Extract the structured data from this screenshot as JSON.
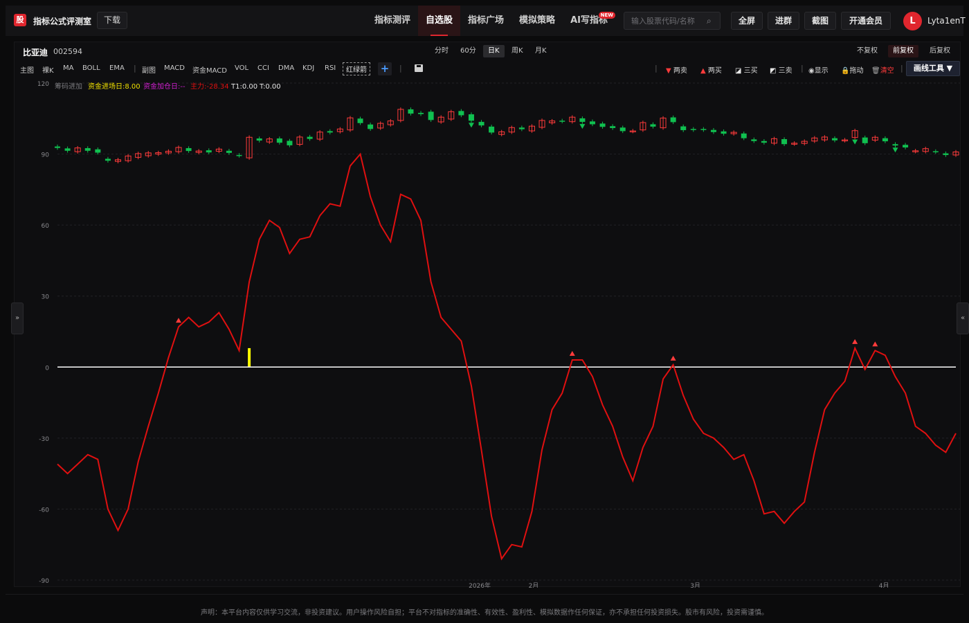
{
  "app": {
    "logo_char": "股",
    "title": "指标公式评测室",
    "download_label": "下载"
  },
  "nav": [
    {
      "label": "指标测评",
      "active": false,
      "badge": ""
    },
    {
      "label": "自选股",
      "active": true,
      "badge": ""
    },
    {
      "label": "指标广场",
      "active": false,
      "badge": ""
    },
    {
      "label": "模拟策略",
      "active": false,
      "badge": ""
    },
    {
      "label": "AI写指标",
      "active": false,
      "badge": "NEW"
    }
  ],
  "search": {
    "placeholder": "输入股票代码/名称"
  },
  "toolbar": {
    "fullscreen": "全屏",
    "join_group": "进群",
    "screenshot": "截图",
    "vip": "开通会员"
  },
  "user": {
    "avatar_letter": "L",
    "name": "Lyta1enT"
  },
  "stock": {
    "name": "比亚迪",
    "code": "002594"
  },
  "periods": [
    "分时",
    "60分",
    "日K",
    "周K",
    "月K"
  ],
  "active_period": "日K",
  "adjustments": [
    "不复权",
    "前复权",
    "后复权"
  ],
  "active_adjustment": "前复权",
  "indicators_main": [
    "主图",
    "裸K",
    "MA",
    "BOLL",
    "EMA"
  ],
  "indicators_sub": [
    "副图",
    "MACD",
    "资金MACD",
    "VOL",
    "CCI",
    "DMA",
    "KDJ",
    "RSI"
  ],
  "red_green_label": "红绿箭",
  "draw_actions": [
    {
      "label": "两卖",
      "icon": "red-down-triangle"
    },
    {
      "label": "两买",
      "icon": "red-up-triangle"
    },
    {
      "label": "三买",
      "icon": "chart-icon"
    },
    {
      "label": "三卖",
      "icon": "chart-icon"
    },
    {
      "label": "显示",
      "icon": "eye-icon"
    },
    {
      "label": "拖动",
      "icon": "lock-icon"
    },
    {
      "label": "清空",
      "icon": "trash-icon"
    }
  ],
  "draw_tools_label": "画线工具 ▼",
  "legend": {
    "chip": "筹码进加",
    "fund_entry": "资金进场日:8.00",
    "fund_add": "资金加仓日:--",
    "main_force": "主力:-28.34",
    "t1": "T1:0.00",
    "t": "T:0.00"
  },
  "colors": {
    "up": "#ff3b3b",
    "down": "#10c050",
    "line": "#e01010",
    "accent": "#e0262e",
    "zero_line": "#ffffff",
    "bar": "#ffff00"
  },
  "chart_data": {
    "type": "line",
    "y_ticks": [
      120,
      90,
      60,
      30,
      0,
      -30,
      -60,
      -90
    ],
    "ylim": [
      -90,
      120
    ],
    "x_labels": [
      "2026年",
      "2月",
      "3月",
      "4月"
    ],
    "series": [
      {
        "name": "主力",
        "values": [
          -41,
          -45,
          -41,
          -37,
          -39,
          -60,
          -69,
          -60,
          -40,
          -25,
          -11,
          4,
          17,
          21,
          17,
          19,
          23,
          16,
          7,
          36,
          54,
          62,
          59,
          48,
          54,
          55,
          64,
          69,
          68,
          85,
          90,
          72,
          60,
          53,
          73,
          71,
          62,
          36,
          21,
          16,
          11,
          -8,
          -35,
          -63,
          -81,
          -75,
          -76,
          -61,
          -35,
          -18,
          -11,
          3,
          3,
          -4,
          -16,
          -25,
          -38,
          -48,
          -34,
          -25,
          -5,
          1,
          -12,
          -22,
          -28,
          -30,
          -34,
          -39,
          -37,
          -48,
          -62,
          -61,
          -66,
          -61,
          -57,
          -36,
          -18,
          -11,
          -6,
          8,
          -1,
          7,
          5,
          -4,
          -11,
          -25,
          -28,
          -33,
          -36,
          -28
        ]
      }
    ],
    "candles": [
      {
        "o": 93.2,
        "c": 92.6
      },
      {
        "o": 92.4,
        "c": 91.4
      },
      {
        "o": 91.0,
        "c": 92.6
      },
      {
        "o": 92.5,
        "c": 91.4
      },
      {
        "o": 92.0,
        "c": 90.6
      },
      {
        "o": 88.0,
        "c": 87.2
      },
      {
        "o": 86.9,
        "c": 87.6
      },
      {
        "o": 87.2,
        "c": 89.2
      },
      {
        "o": 88.6,
        "c": 90.2
      },
      {
        "o": 89.3,
        "c": 90.5
      },
      {
        "o": 90.0,
        "c": 90.6
      },
      {
        "o": 90.5,
        "c": 91.2
      },
      {
        "o": 91.0,
        "c": 92.8
      },
      {
        "o": 92.5,
        "c": 91.3
      },
      {
        "o": 90.7,
        "c": 91.3
      },
      {
        "o": 91.6,
        "c": 90.7
      },
      {
        "o": 91.2,
        "c": 92.1
      },
      {
        "o": 91.4,
        "c": 90.5
      },
      {
        "o": 89.6,
        "c": 89.3
      },
      {
        "o": 88.4,
        "c": 97.1
      },
      {
        "o": 96.6,
        "c": 95.7
      },
      {
        "o": 95.1,
        "c": 96.4
      },
      {
        "o": 96.6,
        "c": 94.8
      },
      {
        "o": 95.6,
        "c": 93.7
      },
      {
        "o": 94.1,
        "c": 97.2
      },
      {
        "o": 97.3,
        "c": 96.4
      },
      {
        "o": 96.3,
        "c": 99.3
      },
      {
        "o": 99.7,
        "c": 99.1
      },
      {
        "o": 99.5,
        "c": 100.6
      },
      {
        "o": 100.2,
        "c": 105.3
      },
      {
        "o": 105.0,
        "c": 103.1
      },
      {
        "o": 102.5,
        "c": 100.6
      },
      {
        "o": 101.0,
        "c": 103.0
      },
      {
        "o": 102.4,
        "c": 104.0
      },
      {
        "o": 104.2,
        "c": 108.9
      },
      {
        "o": 108.9,
        "c": 107.1
      },
      {
        "o": 107.4,
        "c": 106.9
      },
      {
        "o": 107.9,
        "c": 104.4
      },
      {
        "o": 103.6,
        "c": 105.6
      },
      {
        "o": 104.8,
        "c": 107.9
      },
      {
        "o": 108.2,
        "c": 106.4
      },
      {
        "o": 106.8,
        "c": 104.1
      },
      {
        "o": 103.6,
        "c": 102.1
      },
      {
        "o": 101.6,
        "c": 99.1
      },
      {
        "o": 98.3,
        "c": 99.4
      },
      {
        "o": 99.3,
        "c": 101.2
      },
      {
        "o": 101.2,
        "c": 100.5
      },
      {
        "o": 99.8,
        "c": 101.8
      },
      {
        "o": 101.3,
        "c": 104.2
      },
      {
        "o": 103.2,
        "c": 104.0
      },
      {
        "o": 104.1,
        "c": 103.8
      },
      {
        "o": 103.7,
        "c": 105.6
      },
      {
        "o": 105.1,
        "c": 103.6
      },
      {
        "o": 103.8,
        "c": 102.6
      },
      {
        "o": 102.9,
        "c": 101.5
      },
      {
        "o": 101.8,
        "c": 101.0
      },
      {
        "o": 101.2,
        "c": 99.7
      },
      {
        "o": 99.6,
        "c": 99.8
      },
      {
        "o": 100.2,
        "c": 103.3
      },
      {
        "o": 102.6,
        "c": 101.6
      },
      {
        "o": 101.1,
        "c": 105.2
      },
      {
        "o": 105.5,
        "c": 103.5
      },
      {
        "o": 101.7,
        "c": 100.1
      },
      {
        "o": 100.6,
        "c": 100.2
      },
      {
        "o": 100.6,
        "c": 100.2
      },
      {
        "o": 100.2,
        "c": 99.3
      },
      {
        "o": 99.6,
        "c": 98.6
      },
      {
        "o": 98.6,
        "c": 99.2
      },
      {
        "o": 98.7,
        "c": 96.7
      },
      {
        "o": 96.2,
        "c": 95.5
      },
      {
        "o": 95.5,
        "c": 94.8
      },
      {
        "o": 94.6,
        "c": 96.5
      },
      {
        "o": 96.3,
        "c": 94.2
      },
      {
        "o": 94.3,
        "c": 94.6
      },
      {
        "o": 94.5,
        "c": 95.4
      },
      {
        "o": 95.5,
        "c": 96.8
      },
      {
        "o": 96.0,
        "c": 97.2
      },
      {
        "o": 96.7,
        "c": 95.8
      },
      {
        "o": 95.7,
        "c": 96.0
      },
      {
        "o": 97.0,
        "c": 99.9
      },
      {
        "o": 97.0,
        "c": 94.6
      },
      {
        "o": 95.9,
        "c": 97.1
      },
      {
        "o": 96.7,
        "c": 95.4
      },
      {
        "o": 94.2,
        "c": 93.6
      },
      {
        "o": 93.9,
        "c": 92.8
      },
      {
        "o": 91.1,
        "c": 91.4
      },
      {
        "o": 91.1,
        "c": 92.3
      },
      {
        "o": 91.2,
        "c": 90.9
      },
      {
        "o": 90.3,
        "c": 89.6
      },
      {
        "o": 89.6,
        "c": 90.9
      }
    ],
    "up_markers": [
      12,
      51,
      61,
      79,
      81
    ],
    "down_markers": [
      41,
      52,
      79,
      83
    ],
    "bar_marker_index": 19,
    "bar_marker_value": 8
  }
}
